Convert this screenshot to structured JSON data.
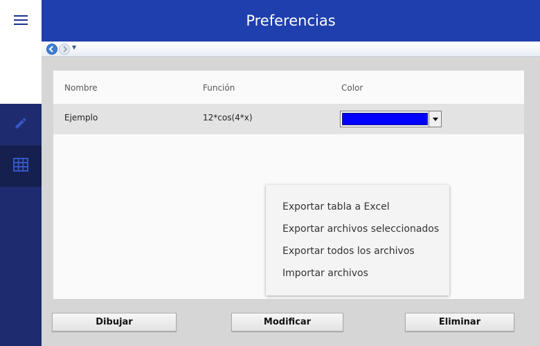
{
  "header": {
    "title": "Preferencias"
  },
  "table": {
    "columns": [
      "Nombre",
      "Función",
      "Color"
    ],
    "rows": [
      {
        "nombre": "Ejemplo",
        "funcion": "12*cos(4*x)",
        "color": "#0000ff"
      }
    ]
  },
  "context_menu": {
    "items": [
      "Exportar tabla a Excel",
      "Exportar archivos seleccionados",
      "Exportar todos los archivos",
      "Importar archivos"
    ]
  },
  "buttons": {
    "draw": "Dibujar",
    "modify": "Modificar",
    "delete": "Eliminar"
  },
  "colors": {
    "header": "#1e3fad",
    "sidebar": "#1e2b6e",
    "sidebar_active": "#15204f",
    "accent": "#1e3fad"
  },
  "icons": {
    "menu": "hamburger-icon",
    "edit": "pencil-icon",
    "table": "table-grid-icon"
  }
}
